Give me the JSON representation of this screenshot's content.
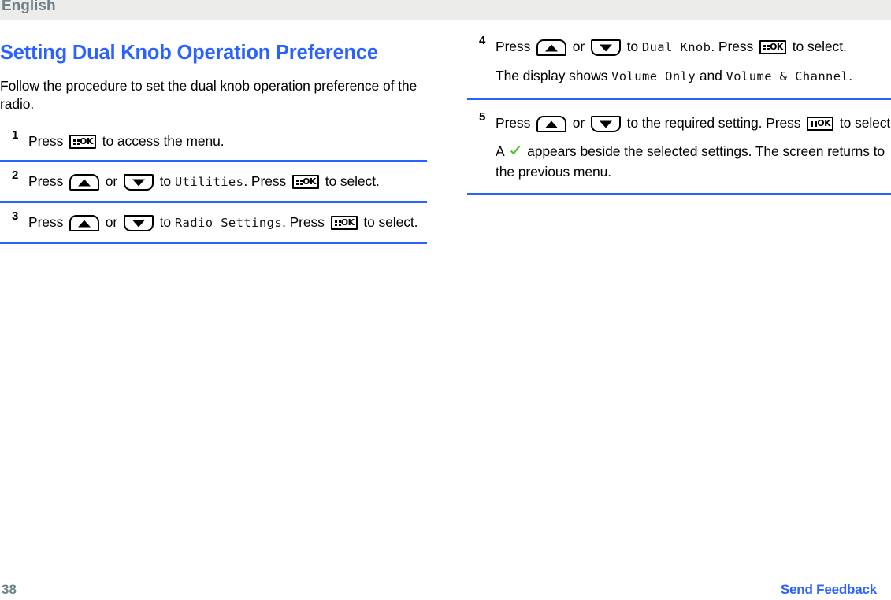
{
  "header": {
    "language": "English"
  },
  "colors": {
    "accent_blue": "#2a62ff",
    "header_gray_band": "#ececea",
    "header_text_gray": "#6f8089",
    "check_green": "#4fbf22",
    "body_text": "#000000"
  },
  "document": {
    "title": "Setting Dual Knob Operation Preference",
    "intro": "Follow the procedure to set the dual knob operation preference of the radio."
  },
  "left_column": {
    "steps": [
      {
        "number": "1",
        "lines": [
          {
            "parts": [
              {
                "type": "text",
                "value": "Press "
              },
              {
                "type": "key",
                "icon": "ok-key-icon",
                "label": "OK"
              },
              {
                "type": "text",
                "value": " to access the menu."
              }
            ]
          }
        ]
      },
      {
        "number": "2",
        "lines": [
          {
            "parts": [
              {
                "type": "text",
                "value": "Press "
              },
              {
                "type": "key",
                "icon": "up-arrow-key-icon"
              },
              {
                "type": "text",
                "value": " or "
              },
              {
                "type": "key",
                "icon": "down-arrow-key-icon"
              },
              {
                "type": "text",
                "value": " to "
              },
              {
                "type": "lcd",
                "value": "Utilities"
              },
              {
                "type": "text",
                "value": ". Press "
              },
              {
                "type": "key",
                "icon": "ok-key-icon",
                "label": "OK"
              },
              {
                "type": "text",
                "value": " to select."
              }
            ]
          }
        ]
      },
      {
        "number": "3",
        "lines": [
          {
            "parts": [
              {
                "type": "text",
                "value": "Press "
              },
              {
                "type": "key",
                "icon": "up-arrow-key-icon"
              },
              {
                "type": "text",
                "value": " or "
              },
              {
                "type": "key",
                "icon": "down-arrow-key-icon"
              },
              {
                "type": "text",
                "value": " to "
              },
              {
                "type": "lcd",
                "value": "Radio Settings"
              },
              {
                "type": "text",
                "value": ". Press "
              },
              {
                "type": "key",
                "icon": "ok-key-icon",
                "label": "OK"
              },
              {
                "type": "text",
                "value": " to select."
              }
            ]
          }
        ]
      }
    ]
  },
  "right_column": {
    "steps": [
      {
        "number": "4",
        "lines": [
          {
            "parts": [
              {
                "type": "text",
                "value": "Press "
              },
              {
                "type": "key",
                "icon": "up-arrow-key-icon"
              },
              {
                "type": "text",
                "value": " or "
              },
              {
                "type": "key",
                "icon": "down-arrow-key-icon"
              },
              {
                "type": "text",
                "value": " to "
              },
              {
                "type": "lcd",
                "value": "Dual Knob"
              },
              {
                "type": "text",
                "value": ". Press "
              },
              {
                "type": "key",
                "icon": "ok-key-icon",
                "label": "OK"
              },
              {
                "type": "text",
                "value": " to select."
              }
            ]
          },
          {
            "parts": [
              {
                "type": "text",
                "value": "The display shows "
              },
              {
                "type": "lcd",
                "value": "Volume Only"
              },
              {
                "type": "text",
                "value": " and "
              },
              {
                "type": "lcd",
                "value": "Volume & Channel"
              },
              {
                "type": "text",
                "value": "."
              }
            ]
          }
        ]
      },
      {
        "number": "5",
        "lines": [
          {
            "parts": [
              {
                "type": "text",
                "value": "Press "
              },
              {
                "type": "key",
                "icon": "up-arrow-key-icon"
              },
              {
                "type": "text",
                "value": " or "
              },
              {
                "type": "key",
                "icon": "down-arrow-key-icon"
              },
              {
                "type": "text",
                "value": " to the required setting. Press "
              },
              {
                "type": "key",
                "icon": "ok-key-icon",
                "label": "OK"
              },
              {
                "type": "text",
                "value": " to select."
              }
            ]
          },
          {
            "parts": [
              {
                "type": "text",
                "value": "A "
              },
              {
                "type": "check",
                "icon": "green-check-icon"
              },
              {
                "type": "text",
                "value": " appears beside the selected settings. The screen returns to the previous menu."
              }
            ]
          }
        ]
      }
    ]
  },
  "footer": {
    "page_number": "38",
    "send_feedback_label": "Send Feedback"
  }
}
